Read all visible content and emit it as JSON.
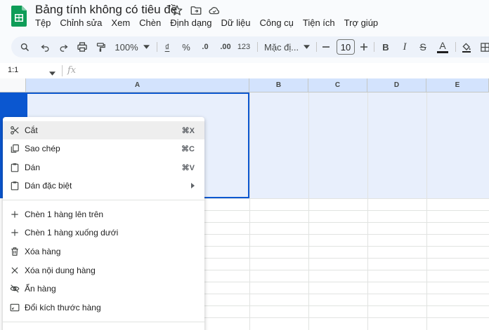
{
  "document": {
    "title": "Bảng tính không có tiêu đề"
  },
  "menubar": [
    "Tệp",
    "Chỉnh sửa",
    "Xem",
    "Chèn",
    "Định dạng",
    "Dữ liệu",
    "Công cụ",
    "Tiện ích",
    "Trợ giúp"
  ],
  "toolbar": {
    "zoom": "100%",
    "currency": "₫",
    "percent": "%",
    "decrease_decimal": ".0",
    "increase_decimal": ".00",
    "number_format": "123",
    "font": "Mặc đị...",
    "font_size": "10",
    "text_color_label": "A",
    "bold": "B",
    "italic": "I",
    "strikethrough": "S"
  },
  "formula_bar": {
    "name_box": "1:1",
    "fx": "fx",
    "value": ""
  },
  "grid": {
    "columns": [
      "A",
      "B",
      "C",
      "D",
      "E"
    ],
    "selected_row": "1",
    "active_cell": "A1"
  },
  "context_menu": {
    "items": [
      {
        "label": "Cắt",
        "shortcut": "⌘X",
        "icon": "scissors-icon"
      },
      {
        "label": "Sao chép",
        "shortcut": "⌘C",
        "icon": "copy-icon"
      },
      {
        "label": "Dán",
        "shortcut": "⌘V",
        "icon": "paste-icon"
      },
      {
        "label": "Dán đặc biệt",
        "shortcut": "",
        "icon": "paste-special-icon",
        "submenu": true
      },
      {
        "label": "Chèn 1 hàng lên trên",
        "shortcut": "",
        "icon": "plus-icon"
      },
      {
        "label": "Chèn 1 hàng xuống dưới",
        "shortcut": "",
        "icon": "plus-icon"
      },
      {
        "label": "Xóa hàng",
        "shortcut": "",
        "icon": "trash-icon"
      },
      {
        "label": "Xóa nội dung hàng",
        "shortcut": "",
        "icon": "close-icon"
      },
      {
        "label": "Ẩn hàng",
        "shortcut": "",
        "icon": "eye-off-icon"
      },
      {
        "label": "Đổi kích thước hàng",
        "shortcut": "",
        "icon": "resize-icon"
      }
    ]
  },
  "colors": {
    "accent": "#0b57d0",
    "selection_fill": "#e8effc",
    "header_selected": "#d3e3fd",
    "toolbar_bg": "#edf2fa",
    "sheets_green": "#0f9d58"
  }
}
